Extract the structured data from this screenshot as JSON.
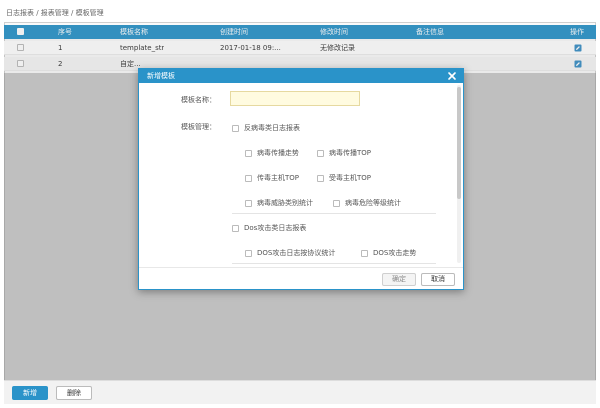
{
  "breadcrumb": "日志报表 / 报表管理 / 模板管理",
  "table": {
    "headers": [
      "序号",
      "模板名称",
      "创建时间",
      "修改时间",
      "备注信息",
      "操作"
    ],
    "rows": [
      {
        "index": "1",
        "name": "template_str",
        "created": "2017-01-18 09:...",
        "modified": "无修改记录",
        "note": ""
      },
      {
        "index": "2",
        "name": "自定...",
        "created": "",
        "modified": "",
        "note": ""
      }
    ]
  },
  "footer": {
    "new_label": "新增",
    "delete_label": "删除"
  },
  "modal": {
    "title": "新增模板",
    "name_label": "模板名称：",
    "name_value": "",
    "manage_label": "模板管理：",
    "groups": [
      {
        "label": "反病毒类日志报表",
        "options": [
          "病毒传播走势",
          "病毒传播TOP",
          "传毒主机TOP",
          "受毒主机TOP",
          "病毒威胁类别统计",
          "病毒危险等级统计"
        ]
      },
      {
        "label": "Dos攻击类日志报表",
        "options": [
          "DOS攻击日志按协议统计",
          "DOS攻击走势"
        ]
      }
    ],
    "ok_label": "确定",
    "cancel_label": "取消"
  },
  "colors": {
    "accent": "#2a93c9",
    "input_bg": "#fffbe0"
  }
}
